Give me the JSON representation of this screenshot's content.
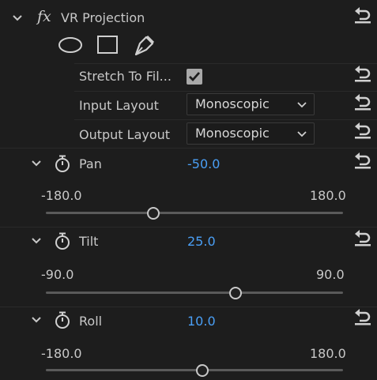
{
  "effect": {
    "fx_symbol": "fx",
    "title": "VR Projection"
  },
  "tools": [
    "ellipse-mask-icon",
    "rectangle-mask-icon",
    "pen-mask-icon"
  ],
  "properties": {
    "stretch": {
      "label": "Stretch To Fil...",
      "checked": true
    },
    "input_layout": {
      "label": "Input Layout",
      "value": "Monoscopic"
    },
    "output_layout": {
      "label": "Output Layout",
      "value": "Monoscopic"
    }
  },
  "params": {
    "pan": {
      "label": "Pan",
      "value": "-50.0",
      "min": "-180.0",
      "max": "180.0",
      "fraction": 0.3611
    },
    "tilt": {
      "label": "Tilt",
      "value": "25.0",
      "min": "-90.0",
      "max": "90.0",
      "fraction": 0.6389
    },
    "roll": {
      "label": "Roll",
      "value": "10.0",
      "min": "-180.0",
      "max": "180.0",
      "fraction": 0.5278
    }
  },
  "colors": {
    "background": "#1d1d1d",
    "value_blue": "#4a9ff5",
    "text": "#c8c8c8",
    "checkbox": "#a9a9a9"
  }
}
